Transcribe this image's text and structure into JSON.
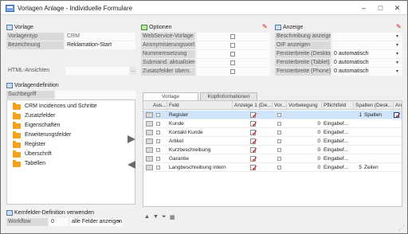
{
  "window": {
    "title": "Vorlagen Anlage - Individuelle Formulare",
    "controls": {
      "minimize": "–",
      "maximize": "□",
      "close": "✕"
    }
  },
  "vorlage": {
    "title": "Vorlage",
    "fields": [
      {
        "label": "Vorlagentyp",
        "value": "CRM"
      },
      {
        "label": "Bezeichnung",
        "value": "Reklamation-Start"
      }
    ],
    "html_label": "HTML-Ansichten",
    "html_btn": "..."
  },
  "optionen": {
    "title": "Optionen",
    "items": [
      {
        "label": "WebService-Vorlage",
        "checked": false
      },
      {
        "label": "Anonymisierungsvorl.",
        "checked": false
      },
      {
        "label": "Nummernsetzung",
        "checked": false
      },
      {
        "label": "Submand. aktualisieren",
        "checked": false
      },
      {
        "label": "Zusatzfelder übern.",
        "checked": false
      }
    ]
  },
  "anzeige": {
    "title": "Anzeige",
    "items": [
      {
        "label": "Beschreibung anzeigen",
        "value": ""
      },
      {
        "label": "OIF anzeigen",
        "value": ""
      },
      {
        "label": "Fensterbreite (Desktop)",
        "value": "0 automatisch"
      },
      {
        "label": "Fensterbreite (Tablet)",
        "value": "0 automatisch"
      },
      {
        "label": "Fensterbreite (Phone)",
        "value": "0 automatisch"
      }
    ]
  },
  "vorlagendefinition": {
    "title": "Vorlagendefinition",
    "search_label": "Suchbegriff",
    "tree": [
      "CRM Incidences und Schritte",
      "Zusatzfelder",
      "Eigenschaften",
      "Erweiterungsfelder",
      "Register",
      "Überschrift",
      "Tabellen"
    ]
  },
  "tabs": [
    "Vorlage",
    "Kopfinformationen"
  ],
  "grid": {
    "headers": [
      "Aus...",
      "Feld",
      "Anzeige 1 (De...",
      "Vor...",
      "Vorbelegung",
      "Pflichtfeld",
      "Spalten (Desk...",
      "Anz"
    ],
    "rows": [
      {
        "feld": "Register",
        "anzeige": true,
        "vor": false,
        "vorbelegung": "",
        "pflicht": "",
        "spalten_num": "1",
        "spalten": "Spalten",
        "anz": true,
        "selected": true
      },
      {
        "feld": "Kunde",
        "anzeige": true,
        "vor": false,
        "vorbelegung": "0",
        "pflicht": "Eingabef...",
        "spalten_num": "",
        "spalten": "",
        "anz": false,
        "selected": false
      },
      {
        "feld": "Kontakt Kunde",
        "anzeige": true,
        "vor": false,
        "vorbelegung": "0",
        "pflicht": "Eingabef...",
        "spalten_num": "",
        "spalten": "",
        "anz": false,
        "selected": false
      },
      {
        "feld": "Artikel",
        "anzeige": true,
        "vor": false,
        "vorbelegung": "0",
        "pflicht": "Eingabef...",
        "spalten_num": "",
        "spalten": "",
        "anz": false,
        "selected": false
      },
      {
        "feld": "Kurzbeschreibung",
        "anzeige": true,
        "vor": false,
        "vorbelegung": "0",
        "pflicht": "Eingabef...",
        "spalten_num": "",
        "spalten": "",
        "anz": false,
        "selected": false
      },
      {
        "feld": "Garantie",
        "anzeige": true,
        "vor": false,
        "vorbelegung": "0",
        "pflicht": "Eingabef...",
        "spalten_num": "",
        "spalten": "",
        "anz": false,
        "selected": false
      },
      {
        "feld": "Langbeschreibung intern",
        "anzeige": true,
        "vor": false,
        "vorbelegung": "0",
        "pflicht": "Eingabef...",
        "spalten_num": "5",
        "spalten": "Zeilen",
        "anz": false,
        "selected": false
      }
    ]
  },
  "kernfelder": {
    "title": "Kernfelder-Definition verwenden",
    "workflow_label": "Workflow",
    "workflow_value": "0",
    "filter_value": "alle Felder anzeigen"
  },
  "colors": {
    "accent": "#d01a1a",
    "selection": "#cfe4f8",
    "folder": "#f4a21a"
  }
}
